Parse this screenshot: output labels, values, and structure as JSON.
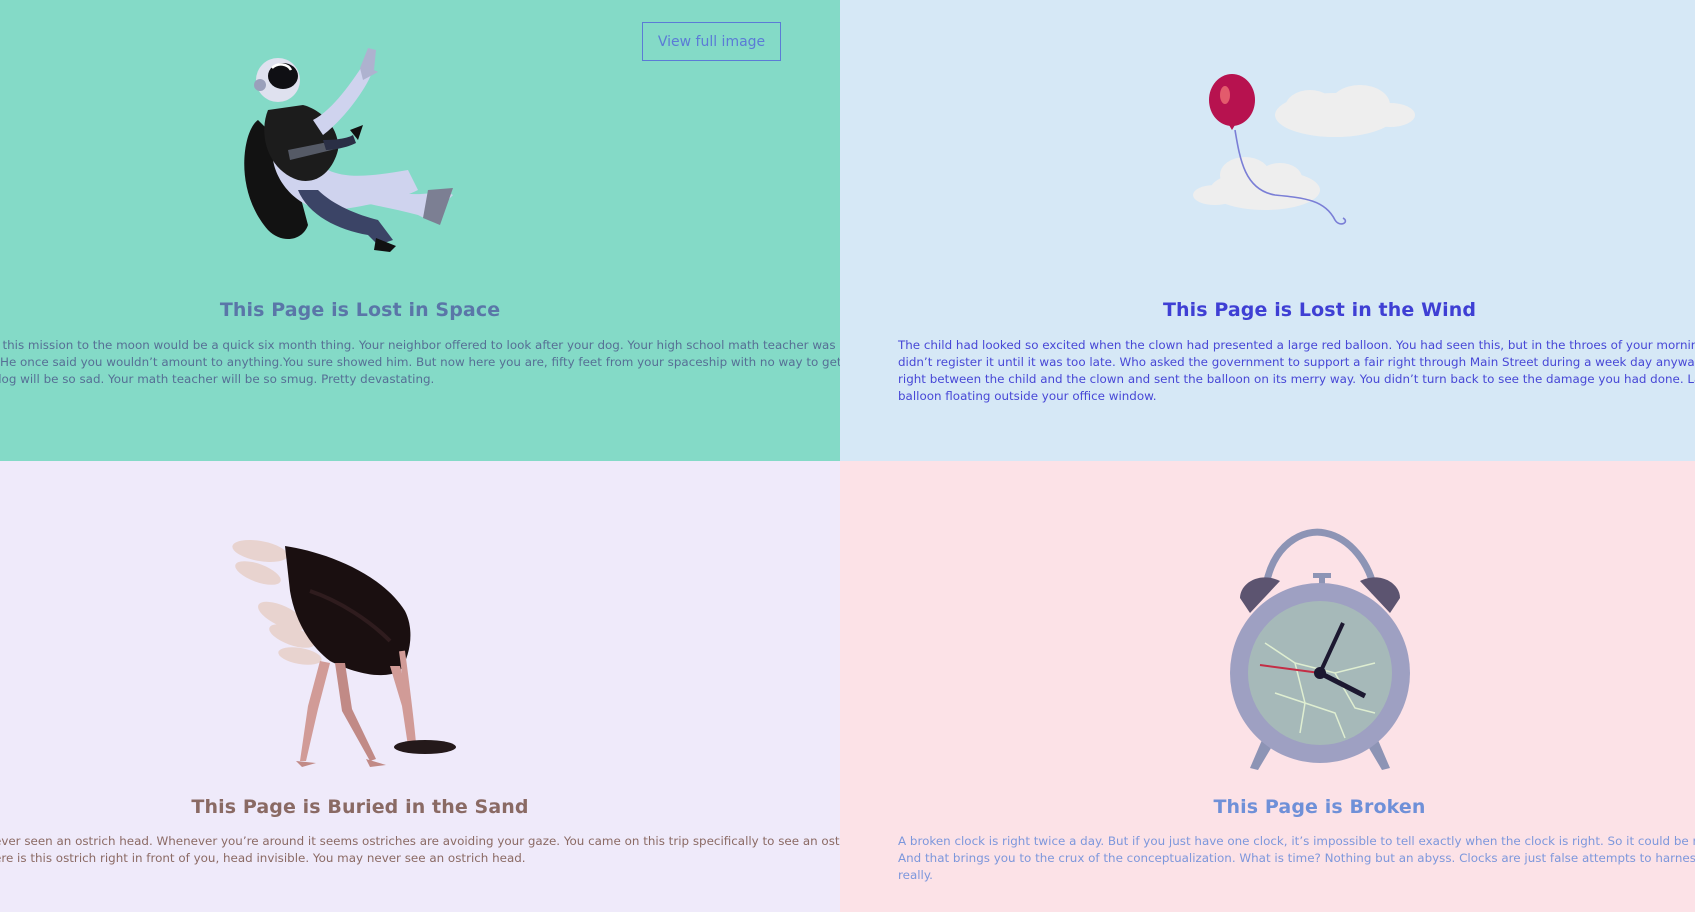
{
  "view_button": {
    "label": "View full image"
  },
  "panels": {
    "space": {
      "title": "This Page is Lost in Space",
      "lines": [
        "t this mission to the moon would be a quick six month thing. Your neighbor offered to look after your dog. Your high school math teacher was",
        "He once said you wouldn’t amount to anything.You sure showed him. But now here you are, fifty feet from your spaceship with no way to get",
        "dog will be so sad. Your math teacher will be so smug. Pretty devastating."
      ],
      "bg": "#84dac7"
    },
    "wind": {
      "title": "This Page is Lost in the Wind",
      "lines": [
        "The child had looked so excited when the clown had presented a large red balloon. You had seen this, but in the throes of your morning commute y",
        "didn’t register it until it was too late. Who asked the government to support a fair right through Main Street during a week day anyway? Your bike ba",
        "right between the child and the clown and sent the balloon on its merry way. You didn’t turn back to see the damage you had done. Later you saw t",
        "balloon floating outside your office window."
      ],
      "bg": "#d6e8f6"
    },
    "sand": {
      "title": "This Page is Buried in the Sand",
      "lines": [
        "ever seen an ostrich head. Whenever you’re around it seems ostriches are avoiding your gaze. You came on this trip specifically to see an ostrich",
        "ere is this ostrich right in front of you, head invisible. You may never see an ostrich head."
      ],
      "bg": "#efeafa"
    },
    "broken": {
      "title": "This Page is Broken",
      "lines": [
        "A broken clock is right twice a day. But if you just have one clock, it’s impossible to tell exactly when the clock is right. So it could be right at any mom",
        "And that brings you to the crux of the conceptualization. What is time? Nothing but an abyss. Clocks are just false attempts to harness its power. It’s",
        "really."
      ],
      "bg": "#fce2e7"
    }
  },
  "illustrations": {
    "space": "astronaut-illustration",
    "wind": "balloon-clouds-illustration",
    "sand": "ostrich-illustration",
    "broken": "broken-clock-illustration"
  }
}
